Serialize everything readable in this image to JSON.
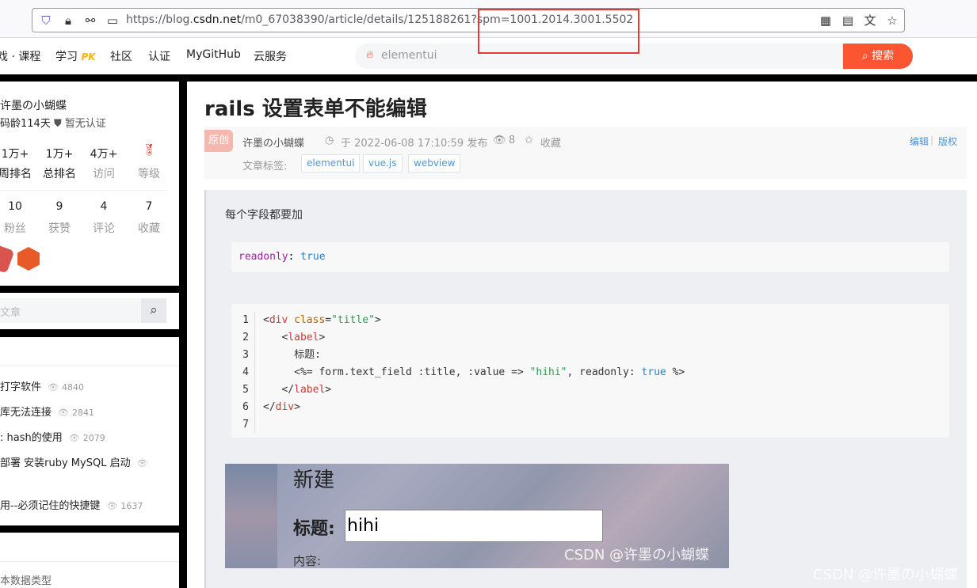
{
  "browser": {
    "url_prefix": "https://blog.",
    "url_domain": "csdn.net",
    "url_rest": "/m0_67038390/article/details/125188261?spm=1001.2014.3001.5502"
  },
  "nav": {
    "items": [
      "戏 · 课程",
      "学习",
      "社区",
      "认证",
      "MyGitHub",
      "云服务"
    ],
    "pk": "PK",
    "search_placeholder": "elementui",
    "search_button": "搜索"
  },
  "profile": {
    "name": "许墨の小蝴蝶",
    "code_age": "码龄114天",
    "verify": "暂无认证",
    "stats1": [
      {
        "n": "1万+",
        "l": "周排名"
      },
      {
        "n": "1万+",
        "l": "总排名"
      },
      {
        "n": "4万+",
        "l": "访问"
      },
      {
        "n": "",
        "l": "等级"
      }
    ],
    "stats2": [
      {
        "n": "10",
        "l": "粉丝"
      },
      {
        "n": "9",
        "l": "获赞"
      },
      {
        "n": "4",
        "l": "评论"
      },
      {
        "n": "7",
        "l": "收藏"
      }
    ]
  },
  "sidebar_search": {
    "placeholder": "文章"
  },
  "hot_list": [
    {
      "title": "打字软件",
      "count": "4840"
    },
    {
      "title": "库无法连接",
      "count": "2841"
    },
    {
      "title": ": hash的使用",
      "count": "2079"
    },
    {
      "title": " 部署 安装ruby MySQL 启动",
      "count": ""
    },
    {
      "title": "用--必须记住的快捷键",
      "count": "1637"
    }
  ],
  "sidebar_bottom": {
    "text": "本数据类型"
  },
  "article": {
    "title": "rails 设置表单不能编辑",
    "badge": "原创",
    "author": "许墨の小蝴蝶",
    "date": "于 2022-06-08 17:10:59 发布",
    "views": "8",
    "favorite": "收藏",
    "edit": "编辑",
    "copyright": "版权",
    "tags_label": "文章标签:",
    "tags": [
      "elementui",
      "vue.js",
      "webview"
    ],
    "intro": "每个字段都要加",
    "code1_key": "readonly",
    "code1_sep": ": ",
    "code1_val": "true",
    "line_numbers": [
      "1",
      "2",
      "3",
      "4",
      "5",
      "6",
      "7"
    ],
    "screenshot": {
      "heading": "新建",
      "label": "标题:",
      "input_value": "hihi",
      "content_label": "内容:",
      "watermark": "CSDN @许墨の小蝴蝶"
    },
    "watermark": "CSDN @许墨の小蝴蝶"
  }
}
